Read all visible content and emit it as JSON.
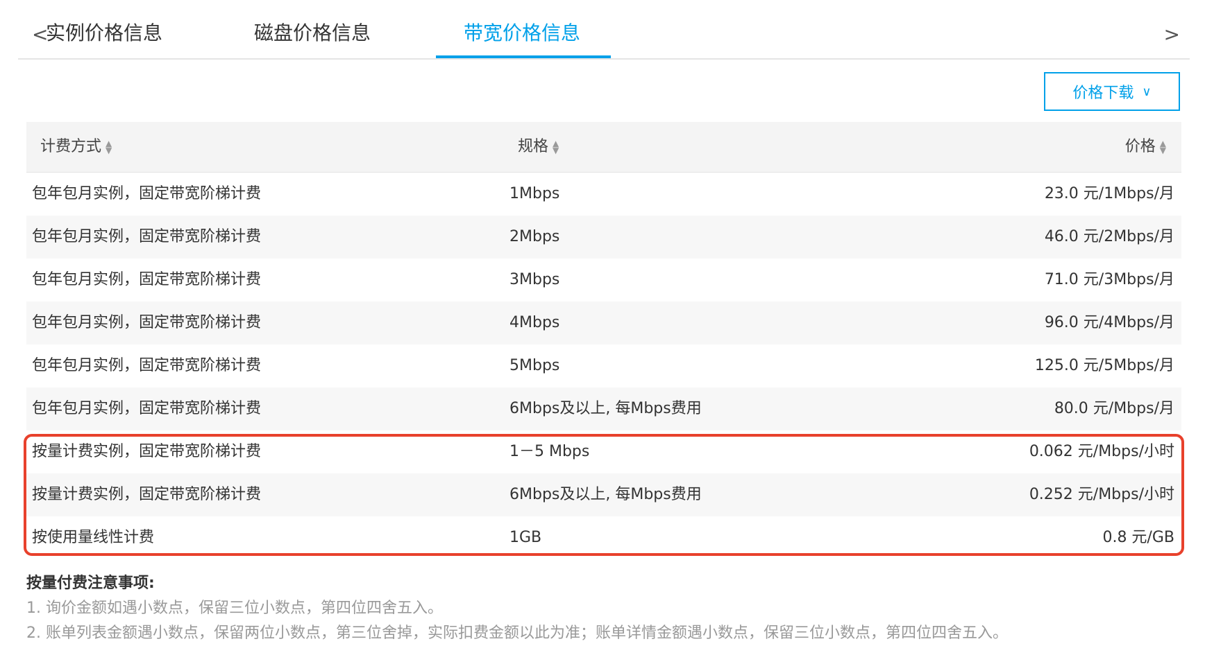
{
  "tabs": {
    "items": [
      "实例价格信息",
      "磁盘价格信息",
      "带宽价格信息"
    ],
    "active_index": 2,
    "left_arrow": "<",
    "right_arrow": ">"
  },
  "download": {
    "label": "价格下载",
    "chevron": "∨"
  },
  "table": {
    "headers": [
      "计费方式",
      "规格",
      "价格"
    ],
    "rows": [
      [
        "包年包月实例，固定带宽阶梯计费",
        "1Mbps",
        "23.0 元/1Mbps/月"
      ],
      [
        "包年包月实例，固定带宽阶梯计费",
        "2Mbps",
        "46.0 元/2Mbps/月"
      ],
      [
        "包年包月实例，固定带宽阶梯计费",
        "3Mbps",
        "71.0 元/3Mbps/月"
      ],
      [
        "包年包月实例，固定带宽阶梯计费",
        "4Mbps",
        "96.0 元/4Mbps/月"
      ],
      [
        "包年包月实例，固定带宽阶梯计费",
        "5Mbps",
        "125.0 元/5Mbps/月"
      ],
      [
        "包年包月实例，固定带宽阶梯计费",
        "6Mbps及以上, 每Mbps费用",
        "80.0 元/Mbps/月"
      ],
      [
        "按量计费实例，固定带宽阶梯计费",
        "1－5 Mbps",
        "0.062 元/Mbps/小时"
      ],
      [
        "按量计费实例，固定带宽阶梯计费",
        "6Mbps及以上, 每Mbps费用",
        "0.252 元/Mbps/小时"
      ],
      [
        "按使用量线性计费",
        "1GB",
        "0.8 元/GB"
      ]
    ]
  },
  "notes": {
    "title": "按量付费注意事项:",
    "items": [
      "1. 询价金额如遇小数点，保留三位小数点，第四位四舍五入。",
      "2. 账单列表金额遇小数点，保留两位小数点，第三位舍掉，实际扣费金额以此为准；账单详情金额遇小数点，保留三位小数点，第四位四舍五入。"
    ]
  },
  "colors": {
    "accent": "#00a0e9",
    "highlight": "#e8412c"
  }
}
